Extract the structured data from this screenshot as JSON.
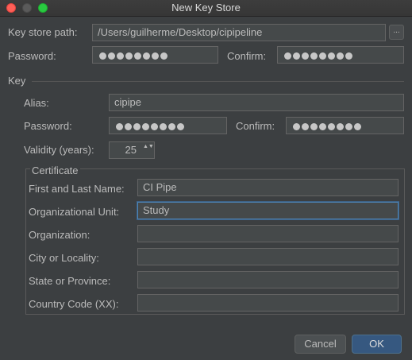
{
  "window": {
    "title": "New Key Store"
  },
  "keystore": {
    "path_label": "Key store path:",
    "path_value": "/Users/guilherme/Desktop/cipipeline",
    "browse_label": "...",
    "password_label": "Password:",
    "confirm_label": "Confirm:"
  },
  "key": {
    "section_label": "Key",
    "alias_label": "Alias:",
    "alias_value": "cipipe",
    "password_label": "Password:",
    "confirm_label": "Confirm:",
    "validity_label": "Validity (years):",
    "validity_value": "25",
    "spinner_arrows": "▲▼"
  },
  "certificate": {
    "group_label": "Certificate",
    "fields": [
      {
        "label": "First and Last Name:",
        "value": "CI Pipe"
      },
      {
        "label": "Organizational Unit:",
        "value": "Study"
      },
      {
        "label": "Organization:",
        "value": ""
      },
      {
        "label": "City or Locality:",
        "value": ""
      },
      {
        "label": "State or Province:",
        "value": ""
      },
      {
        "label": "Country Code (XX):",
        "value": ""
      }
    ]
  },
  "buttons": {
    "cancel": "Cancel",
    "ok": "OK"
  },
  "colors": {
    "background": "#3c3f41",
    "accent": "#365880",
    "focus": "#4d84b6"
  }
}
